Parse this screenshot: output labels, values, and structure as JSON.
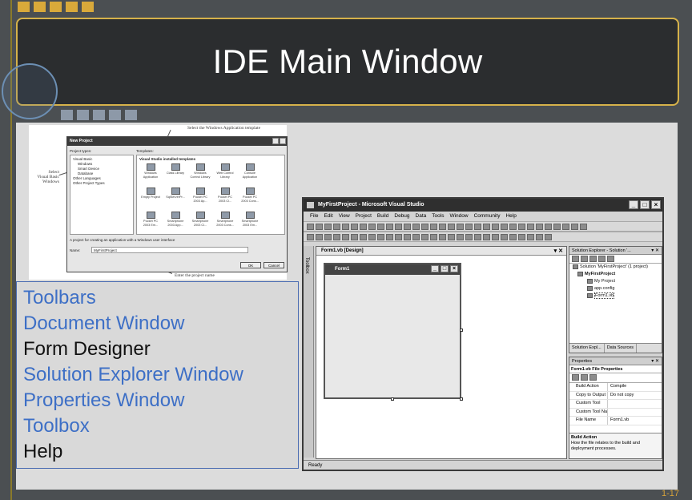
{
  "slide": {
    "title": "IDE Main Window",
    "page_number": "1-17",
    "colors": {
      "title_border": "#d6b24a",
      "bullet_blue": "#3d6fc6",
      "background": "#4b4f52"
    }
  },
  "bullets": [
    {
      "text": "Toolbars",
      "color": "blue"
    },
    {
      "text": "Document Window",
      "color": "blue"
    },
    {
      "text": "Form Designer",
      "color": "black"
    },
    {
      "text": "Solution Explorer Window",
      "color": "blue"
    },
    {
      "text": "Properties Window",
      "color": "blue"
    },
    {
      "text": "Toolbox",
      "color": "blue"
    },
    {
      "text": "Help",
      "color": "black"
    }
  ],
  "new_project_shot": {
    "dialog_title": "New Project",
    "project_types_label": "Project types:",
    "templates_label": "Templates:",
    "tree": [
      "Visual Basic",
      "Windows",
      "Smart Device",
      "Database",
      "Other Languages",
      "Other Project Types"
    ],
    "installed_header": "Visual Studio installed templates",
    "templates": [
      "Windows Application",
      "Class Library",
      "Windows Control Library",
      "Web Control Library",
      "Console Application",
      "Empty Project",
      "SqlServerPr...",
      "Pocket PC 2003 Ap...",
      "Pocket PC 2003 Cl...",
      "Pocket PC 2003 Cons...",
      "Pocket PC 2003 Em...",
      "Smartphone 2003 App...",
      "Smartphone 2003 Cl...",
      "Smartphone 2003 Cons...",
      "Smartphone 2003 Em..."
    ],
    "description": "A project for creating an application with a Windows user interface",
    "name_label": "Name:",
    "name_value": "MyFirstProject",
    "ok_label": "OK",
    "cancel_label": "Cancel",
    "annot_template": "Select the Windows Application template",
    "annot_select_line1": "Select",
    "annot_select_line2": "Visual Basic",
    "annot_select_line3": "Windows",
    "annot_name": "Enter the project name"
  },
  "vs_shot": {
    "window_title": "MyFirstProject - Microsoft Visual Studio",
    "menu": [
      "File",
      "Edit",
      "View",
      "Project",
      "Build",
      "Debug",
      "Data",
      "Tools",
      "Window",
      "Community",
      "Help"
    ],
    "toolbox_label": "Toolbox",
    "doc_tab": "Form1.vb [Design]",
    "form_title": "Form1",
    "solution_explorer_title": "Solution Explorer - Solution '...",
    "solution_tree": [
      "Solution 'MyFirstProject' (1 project)",
      "MyFirstProject",
      "My Project",
      "app.config",
      "Form1.vb"
    ],
    "sol_tab1": "Solution Expl...",
    "sol_tab2": "Data Sources",
    "properties_title": "Properties",
    "prop_selector": "Form1.vb File Properties",
    "properties": [
      {
        "name": "Build Action",
        "value": "Compile"
      },
      {
        "name": "Copy to Output Dir",
        "value": "Do not copy"
      },
      {
        "name": "Custom Tool",
        "value": ""
      },
      {
        "name": "Custom Tool Nam",
        "value": ""
      },
      {
        "name": "File Name",
        "value": "Form1.vb"
      }
    ],
    "prop_desc_title": "Build Action",
    "prop_desc_text": "How the file relates to the build and deployment processes.",
    "status": "Ready"
  }
}
